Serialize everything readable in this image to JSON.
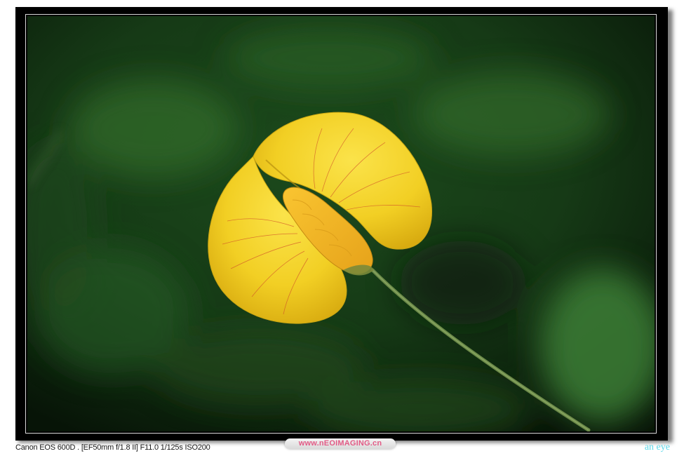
{
  "caption": {
    "camera_info": "Canon EOS 600D . [EF50mm f/1.8 II] F11.0 1/125s ISO200",
    "site_watermark": "www.nEOIMAGING.cn",
    "signature": "an eye"
  },
  "photo": {
    "subject": "yellow-flower-icon",
    "colors": {
      "background_dark": "#0c1e0c",
      "background_green": "#2f6a2a",
      "petal_yellow": "#f3d52e",
      "petal_shadow": "#c9a513",
      "vein_red": "#d2552a",
      "stem_green": "#5e7a3c"
    }
  }
}
